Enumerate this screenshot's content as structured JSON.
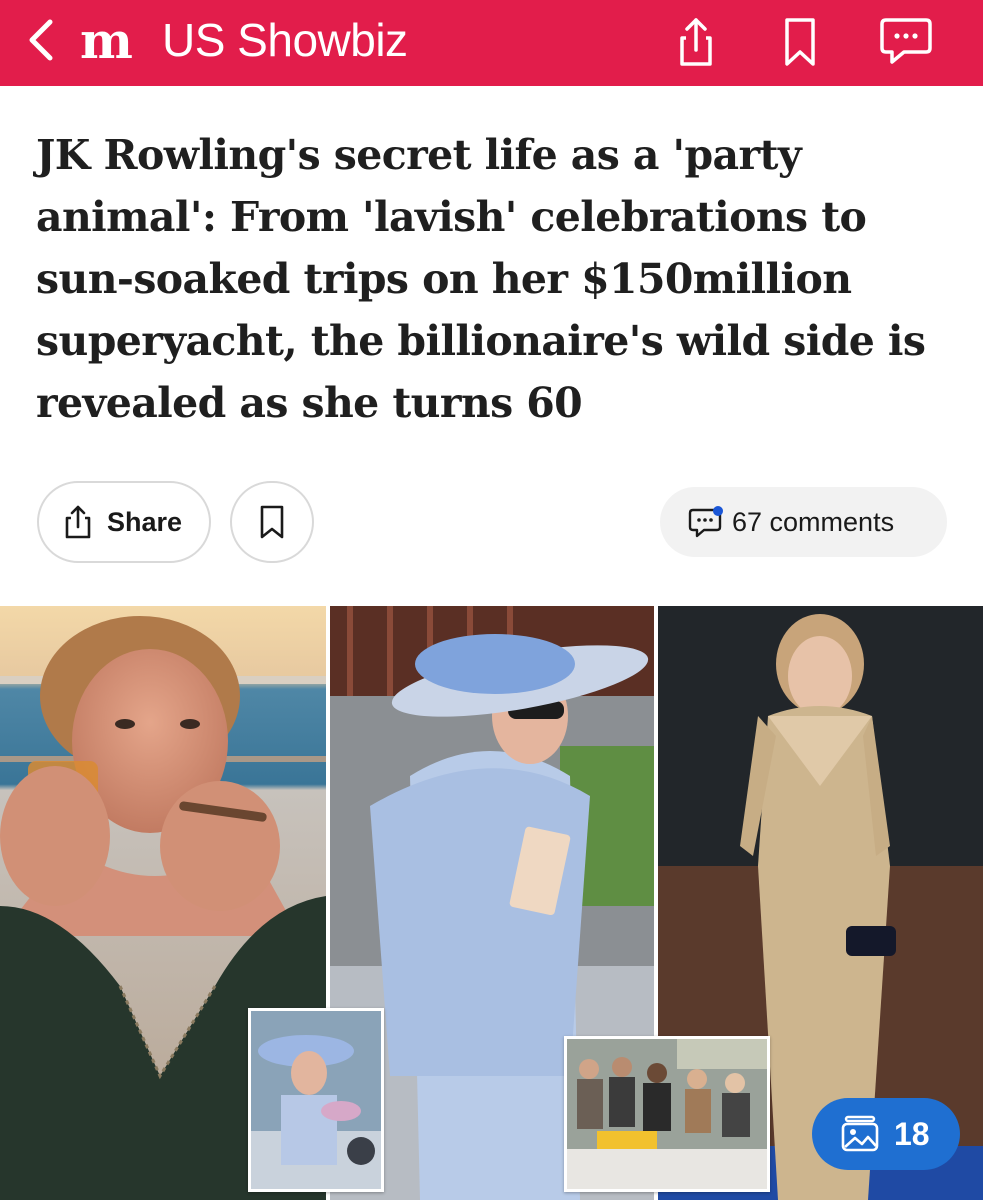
{
  "header": {
    "section_title": "US Showbiz"
  },
  "article": {
    "headline": "JK Rowling's secret life as a 'party animal': From 'lavish' celebrations to sun-soaked trips on her $150million superyacht, the billionaire's wild side is revealed as she turns 60"
  },
  "actions": {
    "share_label": "Share",
    "comments_label": "67 comments"
  },
  "gallery": {
    "count": "18"
  },
  "colors": {
    "brand_red": "#e21d4b",
    "gallery_blue": "#1f6fd1",
    "comment_dot": "#1a56d6"
  },
  "icons": [
    "back-chevron-icon",
    "mail-logo-icon",
    "share-icon",
    "bookmark-icon",
    "comment-icon",
    "gallery-icon"
  ]
}
